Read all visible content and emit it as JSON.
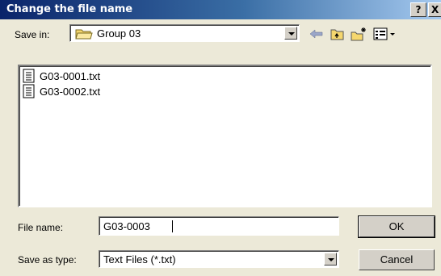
{
  "window": {
    "title": "Change the file name",
    "help_label": "?",
    "close_label": "X"
  },
  "save_in": {
    "label": "Save in:",
    "value": "Group 03",
    "icon": "folder-icon"
  },
  "toolbar": {
    "back_icon": "back-arrow-icon",
    "up_icon": "up-one-level-icon",
    "new_folder_icon": "new-folder-icon",
    "views_icon": "views-menu-icon"
  },
  "files": [
    {
      "name": "G03-0001.txt",
      "icon": "text-file-icon"
    },
    {
      "name": "G03-0002.txt",
      "icon": "text-file-icon"
    }
  ],
  "file_name": {
    "label": "File name:",
    "value": "G03-0003"
  },
  "save_as_type": {
    "label": "Save as type:",
    "value": "Text Files (*.txt)"
  },
  "buttons": {
    "ok": "OK",
    "cancel": "Cancel"
  },
  "colors": {
    "title_start": "#0a246a",
    "title_end": "#a6caf0",
    "dialog_bg": "#ece9d8",
    "folder": "#f5d76e"
  }
}
